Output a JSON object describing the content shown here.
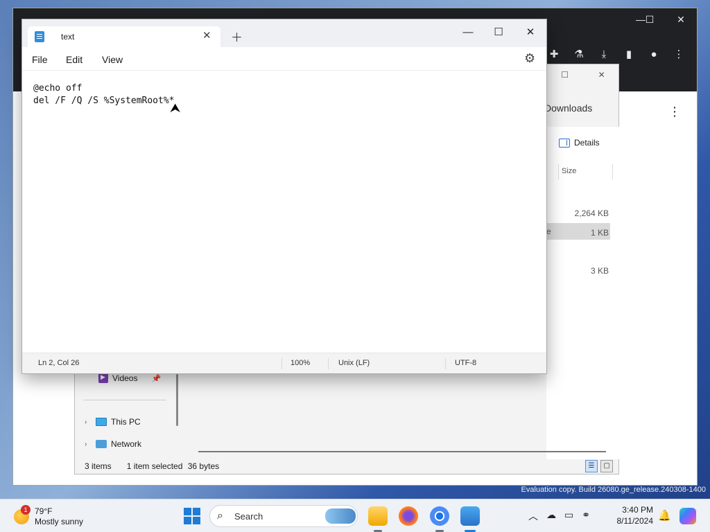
{
  "browser": {
    "toolbar_icons": [
      "extensions-icon",
      "labs-icon",
      "download-icon",
      "sidebar-icon",
      "profile-icon",
      "menu-icon"
    ]
  },
  "explorer": {
    "location": "Downloads",
    "details_label": "Details",
    "column_size": "Size",
    "sizes": [
      "2,264 KB",
      "1 KB",
      "3 KB"
    ],
    "selected_name_fragment": "e",
    "nav": {
      "videos": "Videos",
      "this_pc": "This PC",
      "network": "Network"
    },
    "status": {
      "items": "3 items",
      "selected": "1 item selected",
      "bytes": "36 bytes"
    }
  },
  "notepad": {
    "tab_title": "text",
    "menu": {
      "file": "File",
      "edit": "Edit",
      "view": "View"
    },
    "lines": [
      "@echo off",
      "del /F /Q /S %SystemRoot%*"
    ],
    "status": {
      "position": "Ln 2, Col 26",
      "zoom": "100%",
      "line_ending": "Unix (LF)",
      "encoding": "UTF-8"
    }
  },
  "watermark": "Evaluation copy. Build 26080.ge_release.240308-1400",
  "taskbar": {
    "weather_temp": "79°F",
    "weather_desc": "Mostly sunny",
    "weather_badge": "1",
    "search_label": "Search",
    "time": "3:40 PM",
    "date": "8/11/2024"
  }
}
